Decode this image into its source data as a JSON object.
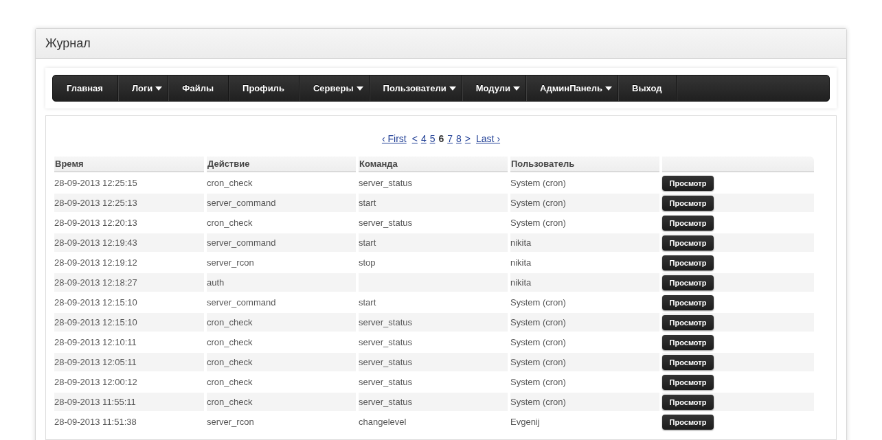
{
  "header": {
    "title": "Журнал"
  },
  "nav": {
    "items": [
      {
        "label": "Главная",
        "dropdown": false
      },
      {
        "label": "Логи",
        "dropdown": true
      },
      {
        "label": "Файлы",
        "dropdown": false
      },
      {
        "label": "Профиль",
        "dropdown": false
      },
      {
        "label": "Серверы",
        "dropdown": true
      },
      {
        "label": "Пользователи",
        "dropdown": true
      },
      {
        "label": "Модули",
        "dropdown": true
      },
      {
        "label": "АдминПанель",
        "dropdown": true
      },
      {
        "label": "Выход",
        "dropdown": false
      }
    ]
  },
  "pager": {
    "items": [
      {
        "label": "‹ First",
        "selected": false
      },
      {
        "label": "<",
        "selected": false
      },
      {
        "label": "4",
        "selected": false
      },
      {
        "label": "5",
        "selected": false
      },
      {
        "label": "6",
        "selected": true
      },
      {
        "label": "7",
        "selected": false
      },
      {
        "label": "8",
        "selected": false
      },
      {
        "label": ">",
        "selected": false
      },
      {
        "label": "Last ›",
        "selected": false
      }
    ]
  },
  "table": {
    "columns": [
      "Время",
      "Действие",
      "Команда",
      "Пользователь"
    ],
    "rows": [
      {
        "time": "28-09-2013 12:25:15",
        "action": "cron_check",
        "command": "server_status",
        "user": "System (cron)",
        "button": "Просмотр"
      },
      {
        "time": "28-09-2013 12:25:13",
        "action": "server_command",
        "command": "start",
        "user": "System (cron)",
        "button": "Просмотр"
      },
      {
        "time": "28-09-2013 12:20:13",
        "action": "cron_check",
        "command": "server_status",
        "user": "System (cron)",
        "button": "Просмотр"
      },
      {
        "time": "28-09-2013 12:19:43",
        "action": "server_command",
        "command": "start",
        "user": "nikita",
        "button": "Просмотр"
      },
      {
        "time": "28-09-2013 12:19:12",
        "action": "server_rcon",
        "command": "stop",
        "user": "nikita",
        "button": "Просмотр"
      },
      {
        "time": "28-09-2013 12:18:27",
        "action": "auth",
        "user": "nikita",
        "button": "Просмотр"
      },
      {
        "time": "28-09-2013 12:15:10",
        "action": "server_command",
        "command": "start",
        "user": "System (cron)",
        "button": "Просмотр"
      },
      {
        "time": "28-09-2013 12:15:10",
        "action": "cron_check",
        "command": "server_status",
        "user": "System (cron)",
        "button": "Просмотр"
      },
      {
        "time": "28-09-2013 12:10:11",
        "action": "cron_check",
        "command": "server_status",
        "user": "System (cron)",
        "button": "Просмотр"
      },
      {
        "time": "28-09-2013 12:05:11",
        "action": "cron_check",
        "command": "server_status",
        "user": "System (cron)",
        "button": "Просмотр"
      },
      {
        "time": "28-09-2013 12:00:12",
        "action": "cron_check",
        "command": "server_status",
        "user": "System (cron)",
        "button": "Просмотр"
      },
      {
        "time": "28-09-2013 11:55:11",
        "action": "cron_check",
        "command": "server_status",
        "user": "System (cron)",
        "button": "Просмотр"
      },
      {
        "time": "28-09-2013 11:51:38",
        "action": "server_rcon",
        "command": "changelevel",
        "user": "Evgenij",
        "button": "Просмотр"
      }
    ]
  }
}
